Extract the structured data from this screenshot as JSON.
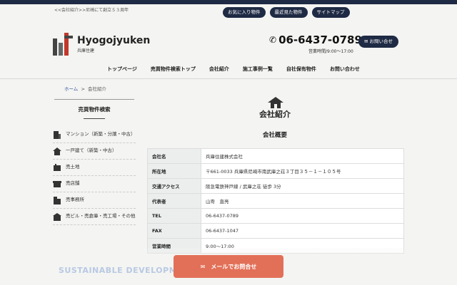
{
  "header": {
    "tagline": "<<会社紹介>>尼崎にて創立５３周年",
    "utility_links": [
      "お気に入り物件",
      "最近見た物件",
      "サイトマップ"
    ],
    "logo_en": "Hyogojyuken",
    "logo_jp": "兵庫住建",
    "phone": "06-6437-0789",
    "hours": "営業時間/9:00～17:00",
    "contact_label": "お問い合せ"
  },
  "nav": [
    "トップページ",
    "売買物件検索トップ",
    "会社紹介",
    "施工事例一覧",
    "自社保有物件",
    "お問い合わせ"
  ],
  "breadcrumb": {
    "home": "ホーム",
    "sep": ">",
    "current": "会社紹介"
  },
  "sidebar": {
    "title": "売買物件検索",
    "items": [
      {
        "label": "マンション（新築・分譲・中古）",
        "icon": "building-icon"
      },
      {
        "label": "一戸建て（新築・中古）",
        "icon": "house-icon"
      },
      {
        "label": "売土地",
        "icon": "land-icon"
      },
      {
        "label": "売店舗",
        "icon": "shop-icon"
      },
      {
        "label": "売事務所",
        "icon": "office-icon"
      },
      {
        "label": "売ビル・売倉庫・売工場・その他",
        "icon": "warehouse-icon"
      }
    ],
    "banner": "SUSTAINABLE DEVELOPMENT"
  },
  "main": {
    "title": "会社紹介",
    "subtitle": "会社概要",
    "rows": [
      {
        "k": "会社名",
        "v": "兵庫住建株式会社"
      },
      {
        "k": "所在地",
        "v": "〒661-0033 兵庫県尼崎市南武庫之荘３丁目３５－１－１０５号"
      },
      {
        "k": "交通アクセス",
        "v": "阪急電鉄神戸線 / 武庫之荘 徒歩 3分"
      },
      {
        "k": "代表者",
        "v": "山嵜　直亮"
      },
      {
        "k": "TEL",
        "v": "06-6437-0789"
      },
      {
        "k": "FAX",
        "v": "06-6437-1047"
      },
      {
        "k": "営業時間",
        "v": "9:00～17:00"
      }
    ]
  },
  "footer_cta": {
    "label": "メールでお問合せ"
  },
  "colors": {
    "navy": "#1f2a44",
    "cta": "#e27058"
  }
}
